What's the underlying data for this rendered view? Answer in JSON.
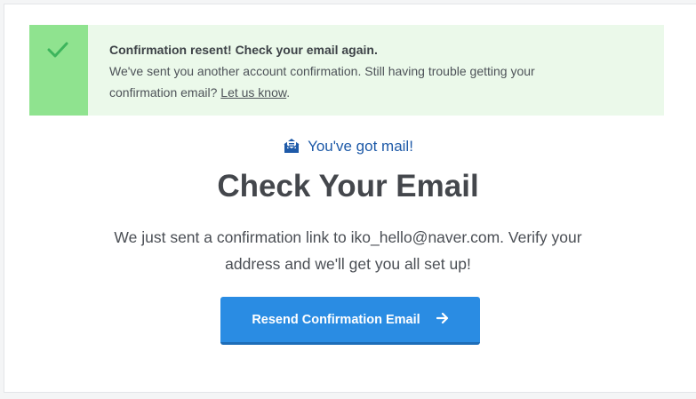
{
  "alert": {
    "title": "Confirmation resent! Check your email again.",
    "message_before_link": "We've sent you another account confirmation. Still having trouble getting your",
    "message_line2_before_link": "confirmation email? ",
    "link_text": "Let us know",
    "message_after_link": ".",
    "icon": "checkmark-icon",
    "stripe_color": "#8fe38f",
    "background_color": "#ebf9ea"
  },
  "main": {
    "mail_label": "You've got mail!",
    "mail_icon": "open-envelope-icon",
    "heading": "Check Your Email",
    "description_line1": "We just sent a confirmation link to iko_hello@naver.com. Verify your",
    "description_line2": "address and we'll get you all set up!",
    "button_label": "Resend Confirmation Email",
    "button_icon": "arrow-right-icon",
    "accent_color": "#2a8ce3"
  }
}
